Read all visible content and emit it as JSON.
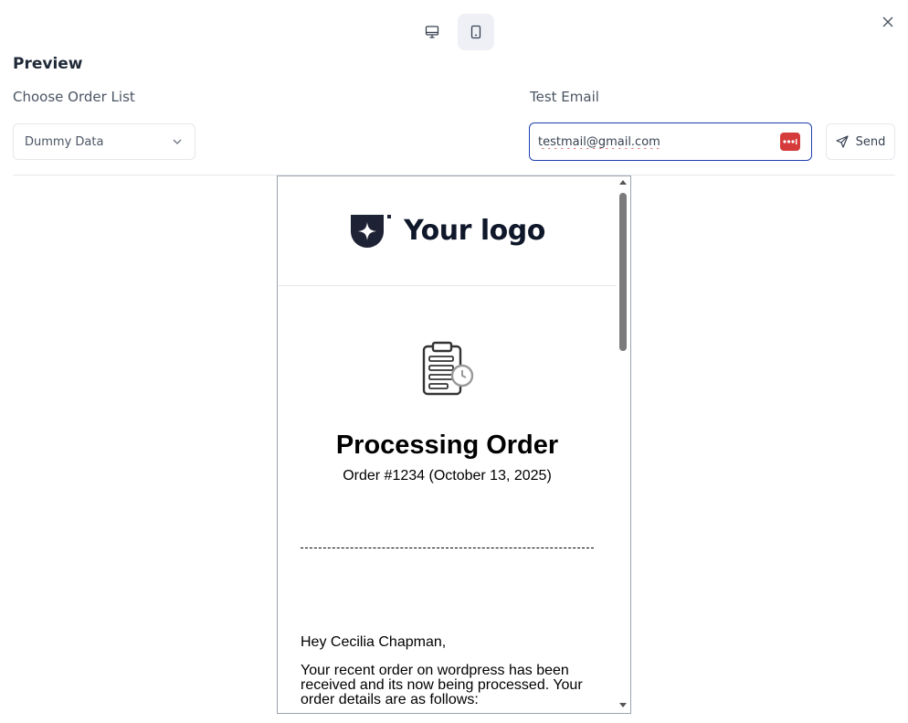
{
  "toolbar": {
    "desktop_icon": "desktop-icon",
    "mobile_icon": "mobile-icon",
    "active_device": "mobile",
    "close_icon": "close-icon"
  },
  "header": {
    "title": "Preview"
  },
  "order_list": {
    "label": "Choose Order List",
    "selected": "Dummy Data",
    "icon": "chevron-down-icon"
  },
  "test_email": {
    "label": "Test Email",
    "value": "testmail@gmail.com",
    "password_manager_icon": "password-manager-icon"
  },
  "send_button": {
    "label": "Send",
    "icon": "send-icon"
  },
  "email_preview": {
    "logo_text": "Your logo",
    "status_icon": "clipboard-clock-icon",
    "heading": "Processing Order",
    "subheading": "Order #1234 (October 13, 2025)",
    "greeting": "Hey Cecilia Chapman,",
    "body": "Your recent order on wordpress has been received and its now being processed. Your order details are as follows:"
  },
  "colors": {
    "accent_border": "#1e40af",
    "active_toggle_bg": "#eef0f6",
    "password_badge": "#d63b3b",
    "logo_color": "#1e2235"
  }
}
